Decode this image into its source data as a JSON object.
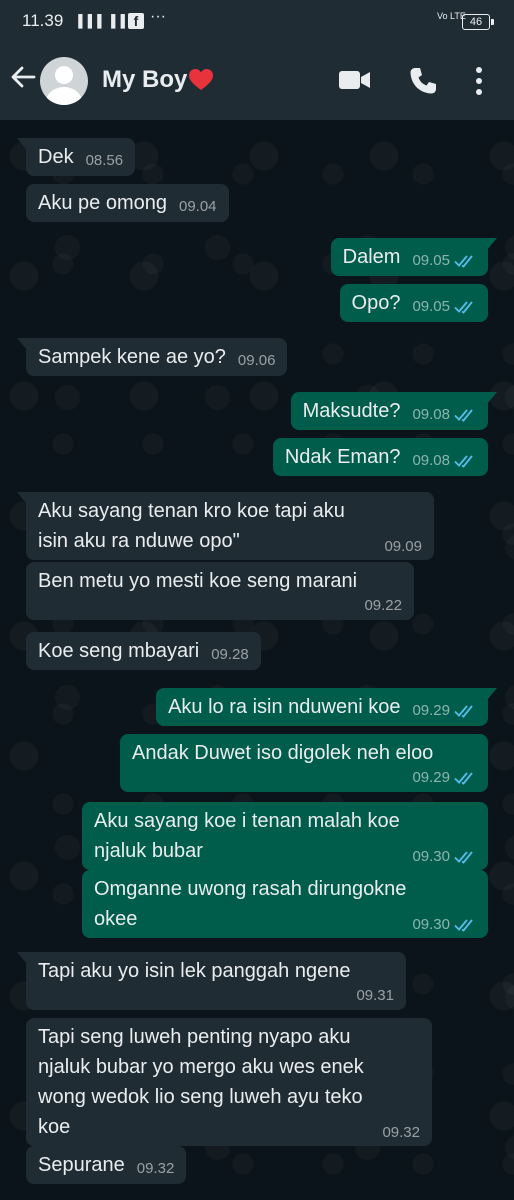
{
  "status_bar": {
    "time": "11.39",
    "signal": "▐▐▐ ▐▐▐",
    "notification_dots": "···",
    "network": "Vo LTE",
    "battery": "46"
  },
  "header": {
    "contact_name": "My Boy",
    "contact_emoji": "heart-icon",
    "icons": [
      "back-arrow-icon",
      "video-call-icon",
      "phone-icon",
      "more-vertical-icon"
    ]
  },
  "colors": {
    "incoming_bubble": "#202c33",
    "outgoing_bubble": "#005c4b",
    "read_ticks": "#53bdeb",
    "header_bg": "#1f2c34"
  },
  "messages": [
    {
      "direction": "in",
      "text": "Dek",
      "time": "08.56"
    },
    {
      "direction": "in",
      "text": "Aku pe omong",
      "time": "09.04"
    },
    {
      "direction": "out",
      "text": "Dalem",
      "time": "09.05",
      "read": true
    },
    {
      "direction": "out",
      "text": "Opo?",
      "time": "09.05",
      "read": true
    },
    {
      "direction": "in",
      "text": "Sampek kene ae yo?",
      "time": "09.06"
    },
    {
      "direction": "out",
      "text": "Maksudte?",
      "time": "09.08",
      "read": true
    },
    {
      "direction": "out",
      "text": "Ndak Eman?",
      "time": "09.08",
      "read": true
    },
    {
      "direction": "in",
      "lines": [
        "Aku sayang tenan kro koe tapi aku",
        "isin aku ra nduwe opo\""
      ],
      "time": "09.09"
    },
    {
      "direction": "in",
      "lines": [
        "Ben metu yo mesti koe seng marani"
      ],
      "time": "09.22"
    },
    {
      "direction": "in",
      "text": "Koe seng mbayari",
      "time": "09.28"
    },
    {
      "direction": "out",
      "text": "Aku lo ra isin nduweni koe",
      "time": "09.29",
      "read": true
    },
    {
      "direction": "out",
      "lines": [
        "Andak Duwet iso digolek neh eloo"
      ],
      "time": "09.29",
      "read": true
    },
    {
      "direction": "out",
      "lines": [
        "Aku sayang koe i tenan malah koe",
        "njaluk bubar"
      ],
      "time": "09.30",
      "read": true
    },
    {
      "direction": "out",
      "lines": [
        "Omganne uwong rasah dirungokne",
        "okee"
      ],
      "time": "09.30",
      "read": true
    },
    {
      "direction": "in",
      "lines": [
        "Tapi aku yo isin lek panggah ngene"
      ],
      "time": "09.31"
    },
    {
      "direction": "in",
      "lines": [
        "Tapi seng luweh penting nyapo aku",
        "njaluk bubar yo mergo aku wes enek",
        "wong wedok lio seng luweh ayu teko",
        "koe"
      ],
      "time": "09.32"
    },
    {
      "direction": "in",
      "text": "Sepurane",
      "time": "09.32"
    }
  ]
}
